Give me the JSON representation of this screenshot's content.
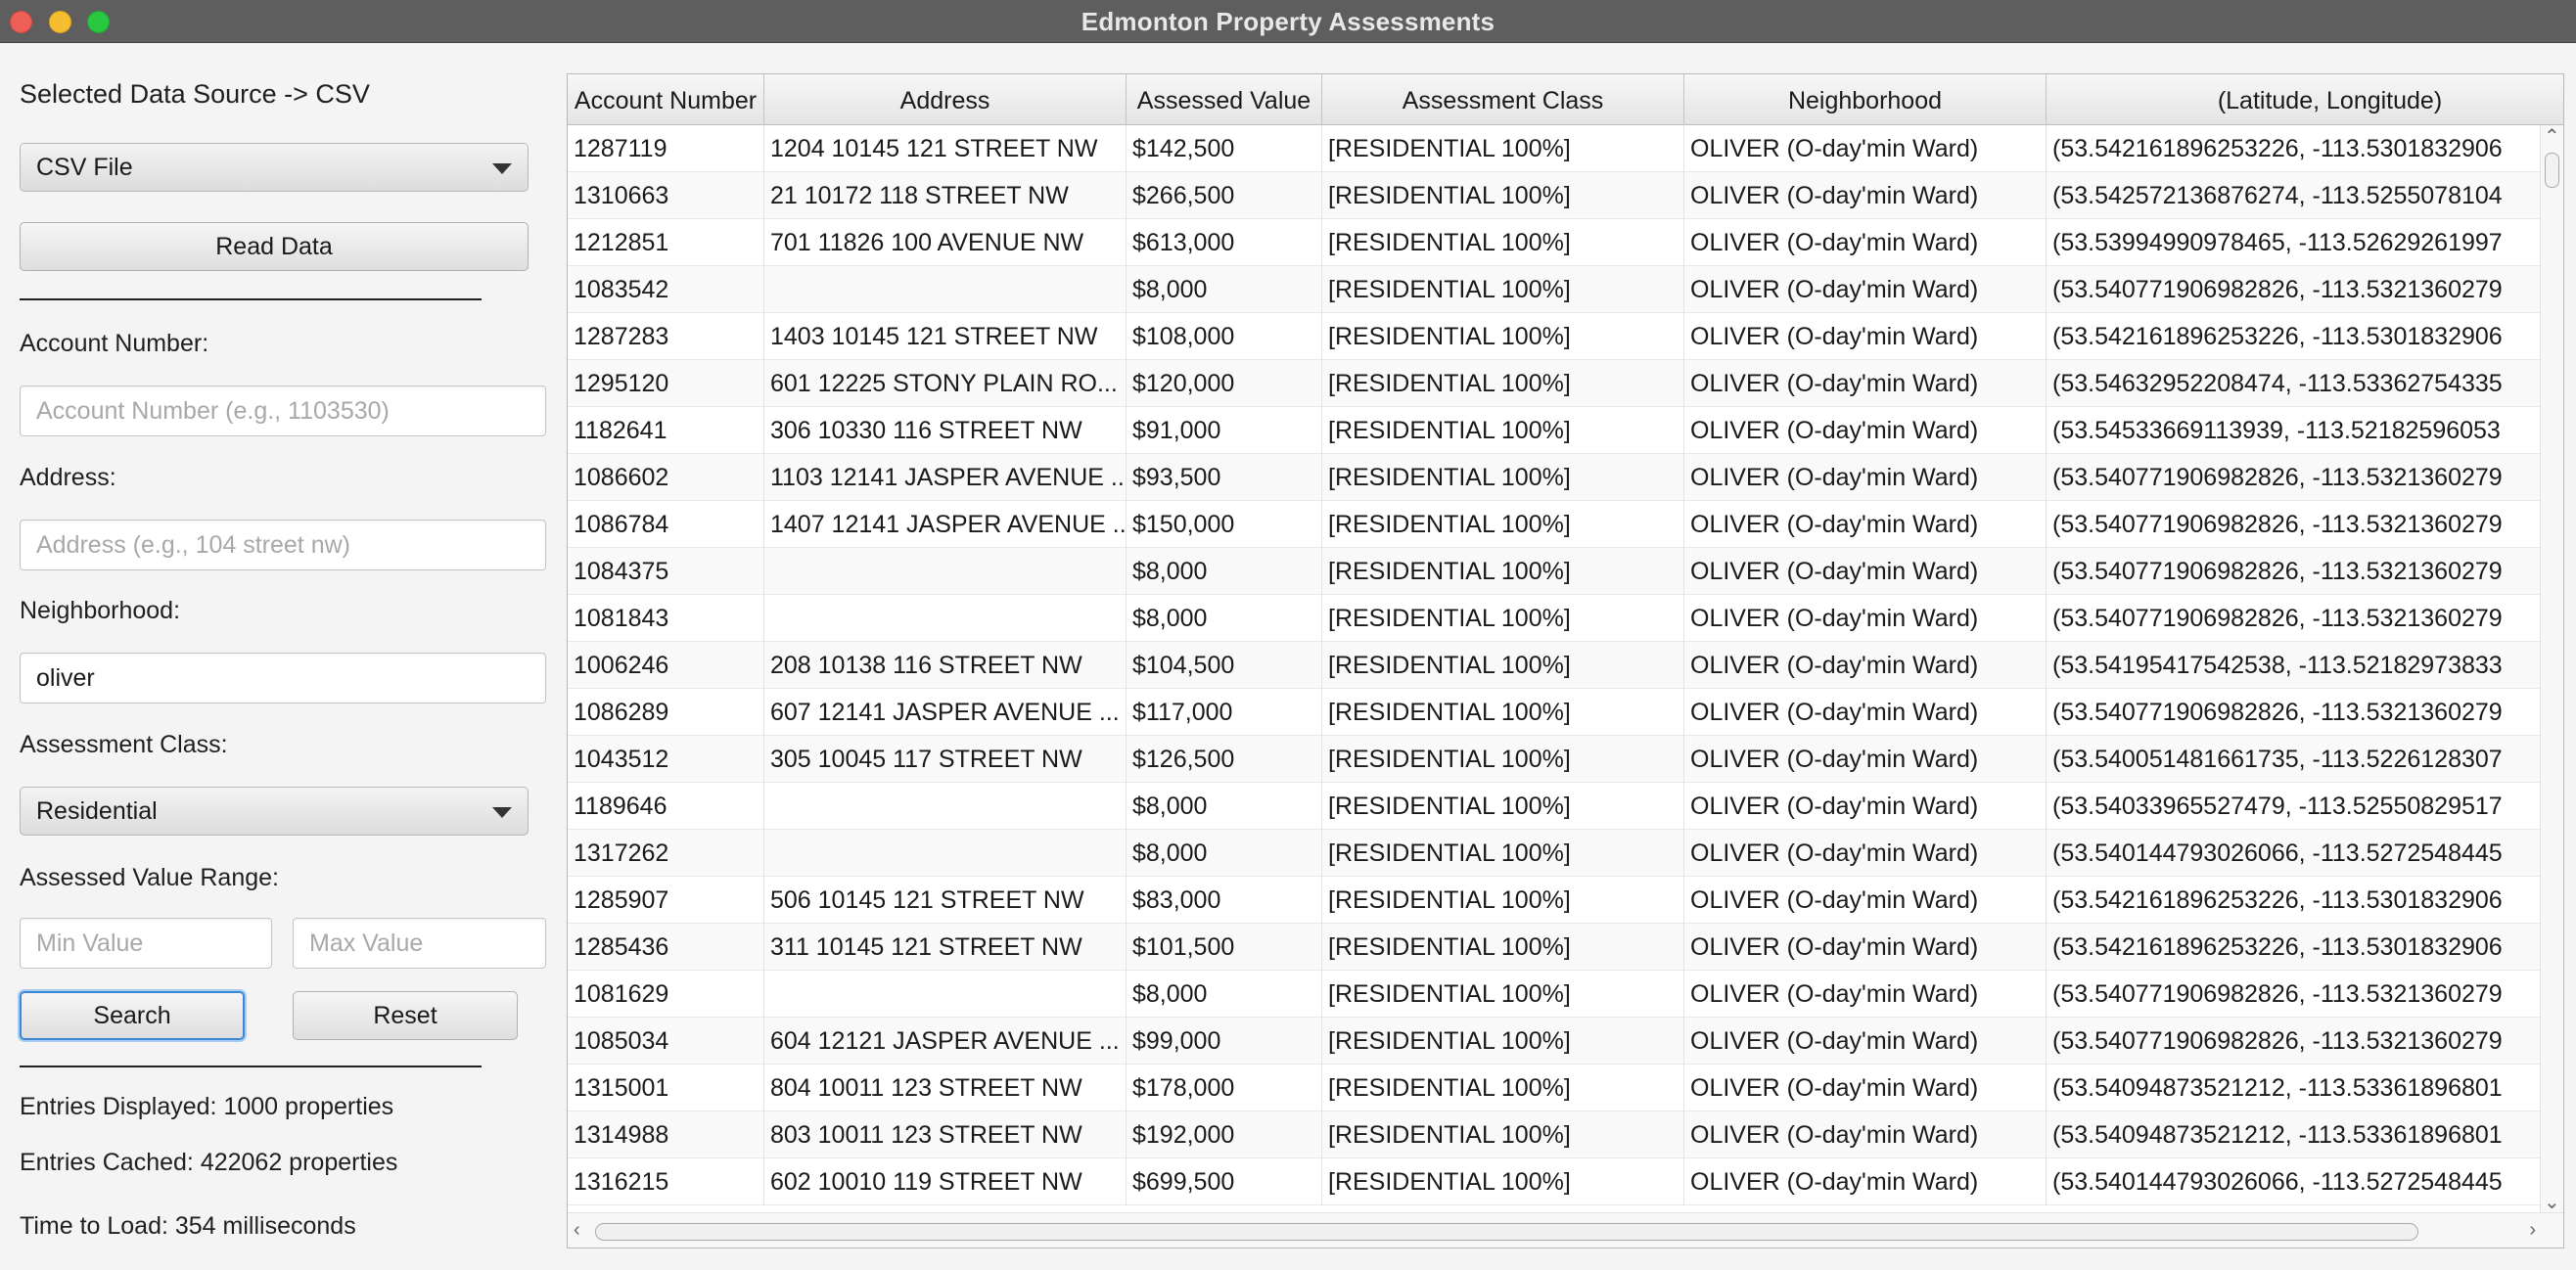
{
  "window": {
    "title": "Edmonton Property Assessments",
    "colors": {
      "close": "#ee5f57",
      "minimize": "#f5bd2f",
      "maximize": "#29c840",
      "focus_ring": "#3b86d6"
    }
  },
  "sidebar": {
    "data_source_label": "Selected Data Source -> CSV",
    "source_select": "CSV File",
    "read_button": "Read Data",
    "account_label": "Account Number:",
    "account_placeholder": "Account Number (e.g., 1103530)",
    "address_label": "Address:",
    "address_placeholder": "Address (e.g., 104 street nw)",
    "neighborhood_label": "Neighborhood:",
    "neighborhood_value": "oliver",
    "class_label": "Assessment Class:",
    "class_select": "Residential",
    "range_label": "Assessed Value Range:",
    "min_placeholder": "Min Value",
    "max_placeholder": "Max Value",
    "search_button": "Search",
    "reset_button": "Reset",
    "entries_displayed": "Entries Displayed: 1000 properties",
    "entries_cached": "Entries Cached: 422062 properties",
    "time_to_load": "Time to Load: 354 milliseconds"
  },
  "table": {
    "columns": [
      "Account Number",
      "Address",
      "Assessed Value",
      "Assessment Class",
      "Neighborhood",
      "(Latitude, Longitude)"
    ],
    "rows": [
      [
        "1287119",
        "1204 10145 121 STREET NW",
        "$142,500",
        "[RESIDENTIAL 100%]",
        "OLIVER (O-day'min Ward)",
        "(53.542161896253226, -113.5301832906"
      ],
      [
        "1310663",
        "21 10172 118 STREET NW",
        "$266,500",
        "[RESIDENTIAL 100%]",
        "OLIVER (O-day'min Ward)",
        "(53.542572136876274, -113.5255078104"
      ],
      [
        "1212851",
        "701 11826 100 AVENUE NW",
        "$613,000",
        "[RESIDENTIAL 100%]",
        "OLIVER (O-day'min Ward)",
        "(53.53994990978465, -113.52629261997"
      ],
      [
        "1083542",
        "",
        "$8,000",
        "[RESIDENTIAL 100%]",
        "OLIVER (O-day'min Ward)",
        "(53.540771906982826, -113.5321360279"
      ],
      [
        "1287283",
        "1403 10145 121 STREET NW",
        "$108,000",
        "[RESIDENTIAL 100%]",
        "OLIVER (O-day'min Ward)",
        "(53.542161896253226, -113.5301832906"
      ],
      [
        "1295120",
        "601 12225 STONY PLAIN RO...",
        "$120,000",
        "[RESIDENTIAL 100%]",
        "OLIVER (O-day'min Ward)",
        "(53.54632952208474, -113.53362754335"
      ],
      [
        "1182641",
        "306 10330 116 STREET NW",
        "$91,000",
        "[RESIDENTIAL 100%]",
        "OLIVER (O-day'min Ward)",
        "(53.54533669113939, -113.52182596053"
      ],
      [
        "1086602",
        "1103 12141 JASPER AVENUE ...",
        "$93,500",
        "[RESIDENTIAL 100%]",
        "OLIVER (O-day'min Ward)",
        "(53.540771906982826, -113.5321360279"
      ],
      [
        "1086784",
        "1407 12141 JASPER AVENUE ...",
        "$150,000",
        "[RESIDENTIAL 100%]",
        "OLIVER (O-day'min Ward)",
        "(53.540771906982826, -113.5321360279"
      ],
      [
        "1084375",
        "",
        "$8,000",
        "[RESIDENTIAL 100%]",
        "OLIVER (O-day'min Ward)",
        "(53.540771906982826, -113.5321360279"
      ],
      [
        "1081843",
        "",
        "$8,000",
        "[RESIDENTIAL 100%]",
        "OLIVER (O-day'min Ward)",
        "(53.540771906982826, -113.5321360279"
      ],
      [
        "1006246",
        "208 10138 116 STREET NW",
        "$104,500",
        "[RESIDENTIAL 100%]",
        "OLIVER (O-day'min Ward)",
        "(53.54195417542538, -113.52182973833"
      ],
      [
        "1086289",
        "607 12141 JASPER AVENUE ...",
        "$117,000",
        "[RESIDENTIAL 100%]",
        "OLIVER (O-day'min Ward)",
        "(53.540771906982826, -113.5321360279"
      ],
      [
        "1043512",
        "305 10045 117 STREET NW",
        "$126,500",
        "[RESIDENTIAL 100%]",
        "OLIVER (O-day'min Ward)",
        "(53.540051481661735, -113.5226128307"
      ],
      [
        "1189646",
        "",
        "$8,000",
        "[RESIDENTIAL 100%]",
        "OLIVER (O-day'min Ward)",
        "(53.54033965527479, -113.52550829517"
      ],
      [
        "1317262",
        "",
        "$8,000",
        "[RESIDENTIAL 100%]",
        "OLIVER (O-day'min Ward)",
        "(53.540144793026066, -113.5272548445"
      ],
      [
        "1285907",
        "506 10145 121 STREET NW",
        "$83,000",
        "[RESIDENTIAL 100%]",
        "OLIVER (O-day'min Ward)",
        "(53.542161896253226, -113.5301832906"
      ],
      [
        "1285436",
        "311 10145 121 STREET NW",
        "$101,500",
        "[RESIDENTIAL 100%]",
        "OLIVER (O-day'min Ward)",
        "(53.542161896253226, -113.5301832906"
      ],
      [
        "1081629",
        "",
        "$8,000",
        "[RESIDENTIAL 100%]",
        "OLIVER (O-day'min Ward)",
        "(53.540771906982826, -113.5321360279"
      ],
      [
        "1085034",
        "604 12121 JASPER AVENUE ...",
        "$99,000",
        "[RESIDENTIAL 100%]",
        "OLIVER (O-day'min Ward)",
        "(53.540771906982826, -113.5321360279"
      ],
      [
        "1315001",
        "804 10011 123 STREET NW",
        "$178,000",
        "[RESIDENTIAL 100%]",
        "OLIVER (O-day'min Ward)",
        "(53.54094873521212, -113.53361896801"
      ],
      [
        "1314988",
        "803 10011 123 STREET NW",
        "$192,000",
        "[RESIDENTIAL 100%]",
        "OLIVER (O-day'min Ward)",
        "(53.54094873521212, -113.53361896801"
      ],
      [
        "1316215",
        "602 10010 119 STREET NW",
        "$699,500",
        "[RESIDENTIAL 100%]",
        "OLIVER (O-day'min Ward)",
        "(53.540144793026066, -113.5272548445"
      ]
    ]
  }
}
